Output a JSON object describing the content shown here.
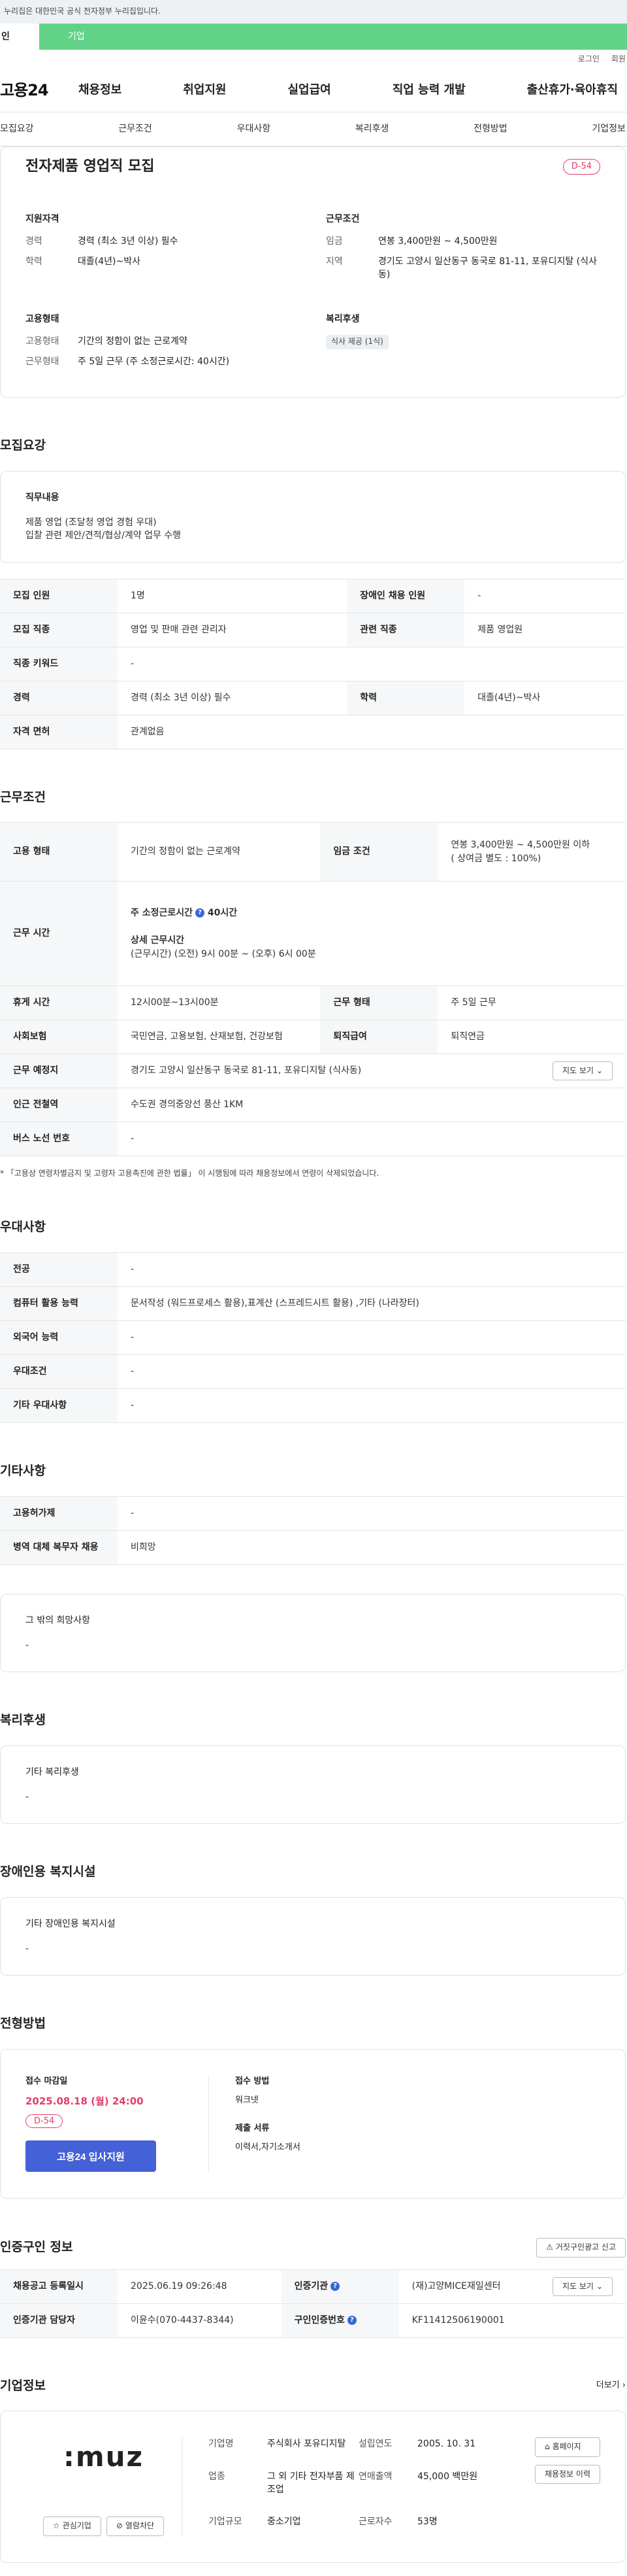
{
  "topbar": {
    "notice": "이 누리집은 대한민국 공식 전자정부 누리집입니다.",
    "notice_shown": "누리집은 대한민국 공식 전자정부 누리집입니다."
  },
  "tabs": {
    "personal": "인",
    "company": "기업"
  },
  "util": {
    "login": "로그인",
    "join": "회원"
  },
  "gnb": {
    "logo": "고용24",
    "menu": [
      "채용정보",
      "취업지원",
      "실업급여",
      "직업 능력 개발",
      "출산휴가·육아휴직"
    ]
  },
  "anchors": [
    "모집요강",
    "근무조건",
    "우대사항",
    "복리후생",
    "전형방법",
    "기업정보"
  ],
  "summary": {
    "title": "전자제품 영업직 모집",
    "dday": "D-54",
    "qual_head": "지원자격",
    "qual": [
      {
        "k": "경력",
        "v": "경력 (최소 3년 이상) 필수"
      },
      {
        "k": "학력",
        "v": "대졸(4년)~박사"
      }
    ],
    "cond_head": "근무조건",
    "cond": [
      {
        "k": "임금",
        "v": "연봉 3,400만원 ~ 4,500만원"
      },
      {
        "k": "지역",
        "v": "경기도 고양시 일산동구 동국로 81-11, 포유디지탈 (식사동)"
      }
    ],
    "emp_head": "고용형태",
    "emp": [
      {
        "k": "고용형태",
        "v": "기간의 정함이 없는 근로계약"
      },
      {
        "k": "근무형태",
        "v": "주 5일 근무 (주 소정근로시간: 40시간)"
      }
    ],
    "welfare_head": "복리후생",
    "welfare_chip": "식사 제공 (1식)"
  },
  "recruit": {
    "title": "모집요강",
    "duty_head": "직무내용",
    "duty_lines": [
      "제품 영업 (조달청 영업 경험 우대)",
      "입찰 관련 제안/견적/협상/계약 업무 수행"
    ],
    "rows": [
      [
        "모집 인원",
        "1명",
        "장애인 채용 인원",
        "-"
      ],
      [
        "모집 직종",
        "영업 및 판매 관련 관리자",
        "관련 직종",
        "제품 영업원"
      ],
      [
        "직종 키워드",
        "-"
      ],
      [
        "경력",
        "경력 (최소 3년 이상) 필수",
        "학력",
        "대졸(4년)~박사"
      ],
      [
        "자격 면허",
        "관계없음"
      ]
    ]
  },
  "work": {
    "title": "근무조건",
    "emp_type_k": "고용 형태",
    "emp_type_v": "기간의 정함이 없는 근로계약",
    "wage_k": "임금 조건",
    "wage_v1": "연봉 3,400만원 ~ 4,500만원 이하",
    "wage_v2": "( 상여금 별도 : 100%)",
    "hours_k": "근무 시간",
    "hours_label": "주 소정근로시간",
    "hours_value": "40시간",
    "detail_label": "상세 근무시간",
    "detail_value": "(근무시간) (오전) 9시 00분 ~ (오후) 6시 00분",
    "rest_k": "휴게 시간",
    "rest_v": "12시00분~13시00분",
    "form_k": "근무 형태",
    "form_v": "주 5일 근무",
    "ins_k": "사회보험",
    "ins_v": "국민연금, 고용보험, 산재보험, 건강보험",
    "ret_k": "퇴직급여",
    "ret_v": "퇴직연금",
    "place_k": "근무 예정지",
    "place_v": "경기도 고양시 일산동구 동국로 81-11, 포유디지탈 (식사동)",
    "map_btn": "지도 보기",
    "station_k": "인근 전철역",
    "station_v": "수도권 경의중앙선 풍산 1KM",
    "bus_k": "버스 노선 번호",
    "bus_v": "-",
    "note": "* 「고용상 연령차별금지 및 고령자 고용촉진에 관한 법률」 이 시행됨에 따라 채용정보에서 연령이 삭제되었습니다."
  },
  "pref": {
    "title": "우대사항",
    "rows": [
      [
        "전공",
        "-"
      ],
      [
        "컴퓨터 활용 능력",
        "문서작성 (워드프로세스 활용),표계산 (스프레드시트 활용) ,기타 (나라장터)"
      ],
      [
        "외국어 능력",
        "-"
      ],
      [
        "우대조건",
        "-"
      ],
      [
        "기타 우대사항",
        "-"
      ]
    ]
  },
  "etc": {
    "title": "기타사항",
    "rows": [
      [
        "고용허가제",
        "-"
      ],
      [
        "병역 대체 복무자 채용",
        "비희망"
      ]
    ],
    "other_head": "그 밖의 희망사항",
    "other_val": "-"
  },
  "welfare": {
    "title": "복리후생",
    "head": "기타 복리후생",
    "val": "-"
  },
  "disabled": {
    "title": "장애인용 복지시설",
    "head": "기타 장애인용 복지시설",
    "val": "-"
  },
  "apply": {
    "title": "전형방법",
    "deadline_label": "접수 마감일",
    "deadline": "2025.08.18 (월) 24:00",
    "dday": "D-54",
    "btn": "고용24 입사지원",
    "method_label": "접수 방법",
    "method": "워크넷",
    "docs_label": "제출 서류",
    "docs": "이력서,자기소개서"
  },
  "cert": {
    "title": "인증구인 정보",
    "report_btn": "거짓구인광고 신고",
    "reg_k": "채용공고 등록일시",
    "reg_v": "2025.06.19 09:26:48",
    "org_k": "인증기관",
    "org_v": "(재)고양MICE재일센터",
    "map_btn": "지도 보기",
    "mgr_k": "인증기관 담당자",
    "mgr_v": "이윤수(070-4437-8344)",
    "num_k": "구인인증번호",
    "num_v": "KF11412506190001"
  },
  "company": {
    "title": "기업정보",
    "more": "더보기",
    "logo_text": ":muz",
    "fav_btn": "관심기업",
    "block_btn": "열람차단",
    "name_k": "기업명",
    "name_v": "주식회사 포유디지탈",
    "est_k": "설립연도",
    "est_v": "2005. 10. 31",
    "ind_k": "업종",
    "ind_v": "그 외 기타 전자부품 제조업",
    "sales_k": "연매출액",
    "sales_v": "45,000 백만원",
    "size_k": "기업규모",
    "size_v": "중소기업",
    "emp_k": "근로자수",
    "emp_v": "53명",
    "home_btn": "홈페이지",
    "hist_btn": "채용정보 이력"
  }
}
